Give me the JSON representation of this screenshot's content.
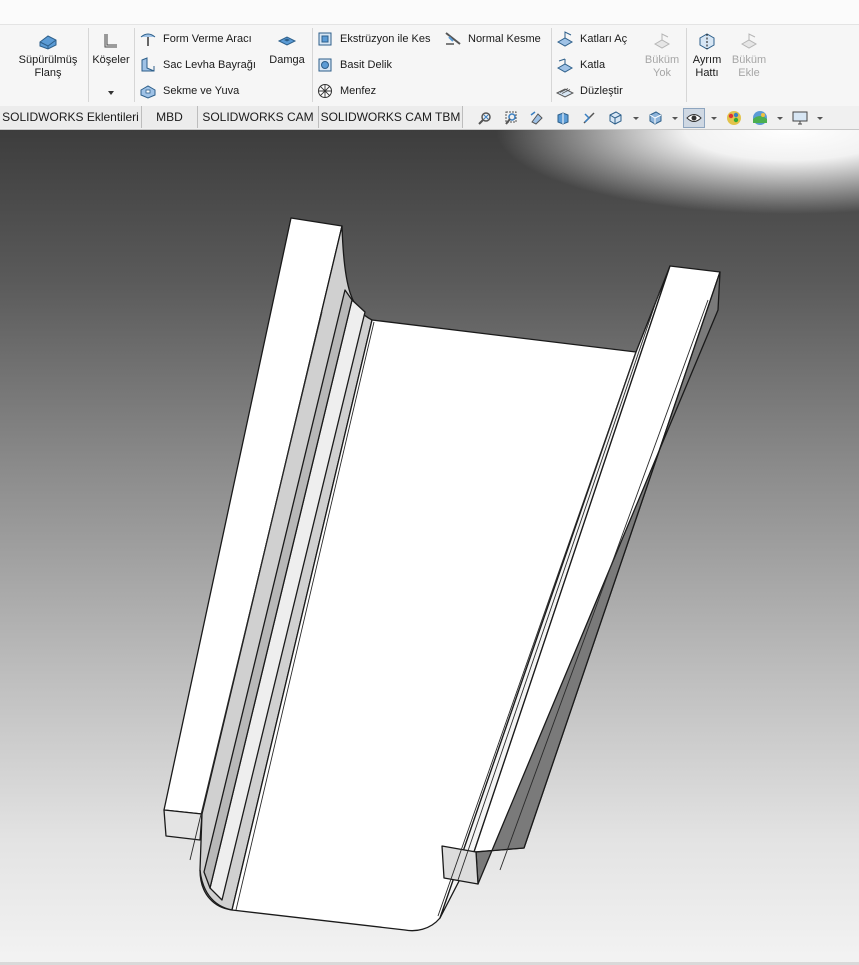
{
  "ribbon": {
    "sweep_flange": "Süpürülmüş\nFlanş",
    "corners": "Köşeler",
    "forming_tool": "Form Verme Aracı",
    "sheet_metal_gusset": "Sac Levha Bayrağı",
    "tab_and_slot": "Sekme ve Yuva",
    "stamp": "Damga",
    "extruded_cut": "Ekstrüzyon ile Kes",
    "simple_hole": "Basit Delik",
    "vent": "Menfez",
    "normal_cut": "Normal Kesme",
    "unfold": "Katları Aç",
    "fold": "Katla",
    "flatten": "Düzleştir",
    "no_bends": "Büküm\nYok",
    "rip_line": "Ayrım\nHattı",
    "insert_bends": "Büküm\nEkle"
  },
  "tabs": [
    {
      "label": "SOLIDWORKS Eklentileri"
    },
    {
      "label": "MBD"
    },
    {
      "label": "SOLIDWORKS CAM"
    },
    {
      "label": "SOLIDWORKS CAM TBM"
    }
  ],
  "view_toolbar": {
    "icons": [
      "zoom-to-fit-icon",
      "zoom-to-area-icon",
      "previous-view-icon",
      "section-view-icon",
      "dynamic-annotation-icon",
      "view-orientation-icon",
      "display-style-icon",
      "hide-show-items-icon",
      "edit-appearance-icon",
      "apply-scene-icon",
      "view-settings-icon"
    ]
  },
  "colors": {
    "ribbon_bg": "#f6f6f6",
    "tab_bg": "#ececec",
    "viewport_top": "#3d3d3d",
    "viewport_bottom": "#f3f3f3",
    "model_face": "#ffffff",
    "model_edge": "#1a1a1a"
  }
}
